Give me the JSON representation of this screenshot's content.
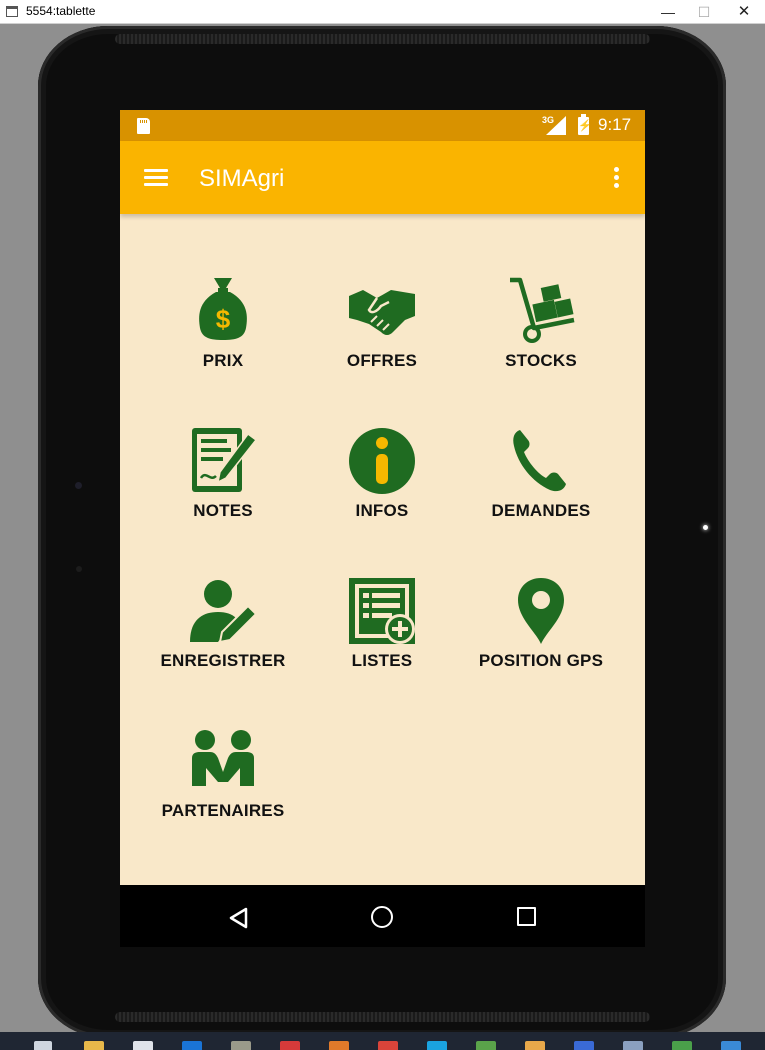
{
  "window": {
    "title": "5554:tablette",
    "minimize": "—",
    "maximize": "☐",
    "close": "✕"
  },
  "statusbar": {
    "network": "3G",
    "time": "9:17"
  },
  "appbar": {
    "title": "SIMAgri",
    "menu_icon": "hamburger-menu-icon",
    "overflow_icon": "more-vert-icon"
  },
  "colors": {
    "statusbar": "#d89200",
    "appbar": "#fab400",
    "background": "#f9e8c9",
    "icon_green": "#1f6b21",
    "icon_yellow": "#f5b800"
  },
  "menu": {
    "items": [
      {
        "label": "PRIX",
        "icon": "money-bag-icon"
      },
      {
        "label": "OFFRES",
        "icon": "handshake-icon"
      },
      {
        "label": "STOCKS",
        "icon": "hand-truck-icon"
      },
      {
        "label": "NOTES",
        "icon": "notes-icon"
      },
      {
        "label": "INFOS",
        "icon": "info-icon"
      },
      {
        "label": "DEMANDES",
        "icon": "phone-icon"
      },
      {
        "label": "ENREGISTRER",
        "icon": "user-edit-icon"
      },
      {
        "label": "LISTES",
        "icon": "list-add-icon"
      },
      {
        "label": "POSITION GPS",
        "icon": "map-pin-icon"
      },
      {
        "label": "PARTENAIRES",
        "icon": "partners-icon"
      }
    ]
  },
  "navbar": {
    "back_icon": "back-icon",
    "home_icon": "home-icon",
    "recents_icon": "recents-icon"
  }
}
